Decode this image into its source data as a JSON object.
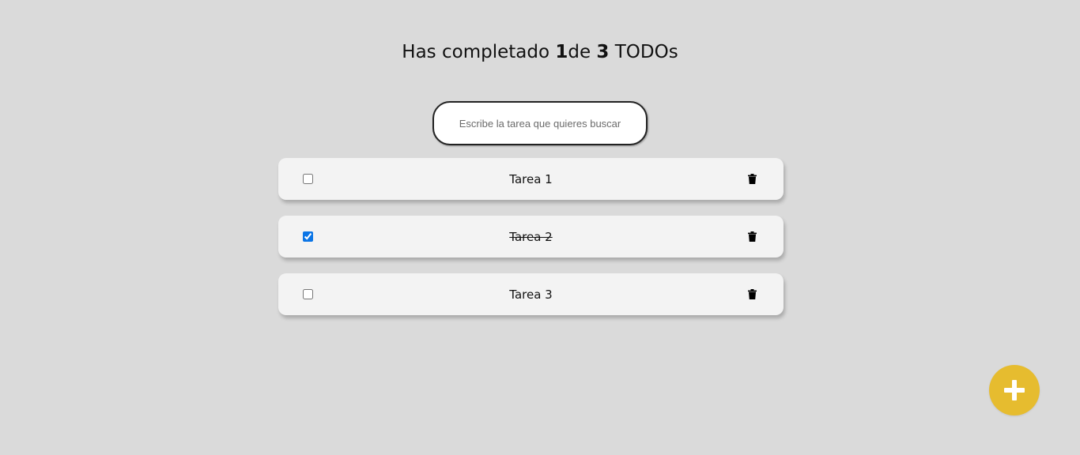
{
  "counter": {
    "prefix": "Has completado ",
    "completed": "1",
    "middle": "de ",
    "total": "3",
    "suffix": " TODOs"
  },
  "search": {
    "placeholder": "Escribe la tarea que quieres buscar",
    "value": ""
  },
  "todos": [
    {
      "text": "Tarea 1",
      "completed": false,
      "delete_icon": "trash-icon"
    },
    {
      "text": "Tarea 2",
      "completed": true,
      "delete_icon": "trash-icon"
    },
    {
      "text": "Tarea 3",
      "completed": false,
      "delete_icon": "trash-icon"
    }
  ],
  "add_button": {
    "icon": "plus-icon"
  },
  "colors": {
    "background": "#dadada",
    "card": "#f3f3f3",
    "accent": "#e6bc2f",
    "checkbox": "#0b75e6"
  }
}
